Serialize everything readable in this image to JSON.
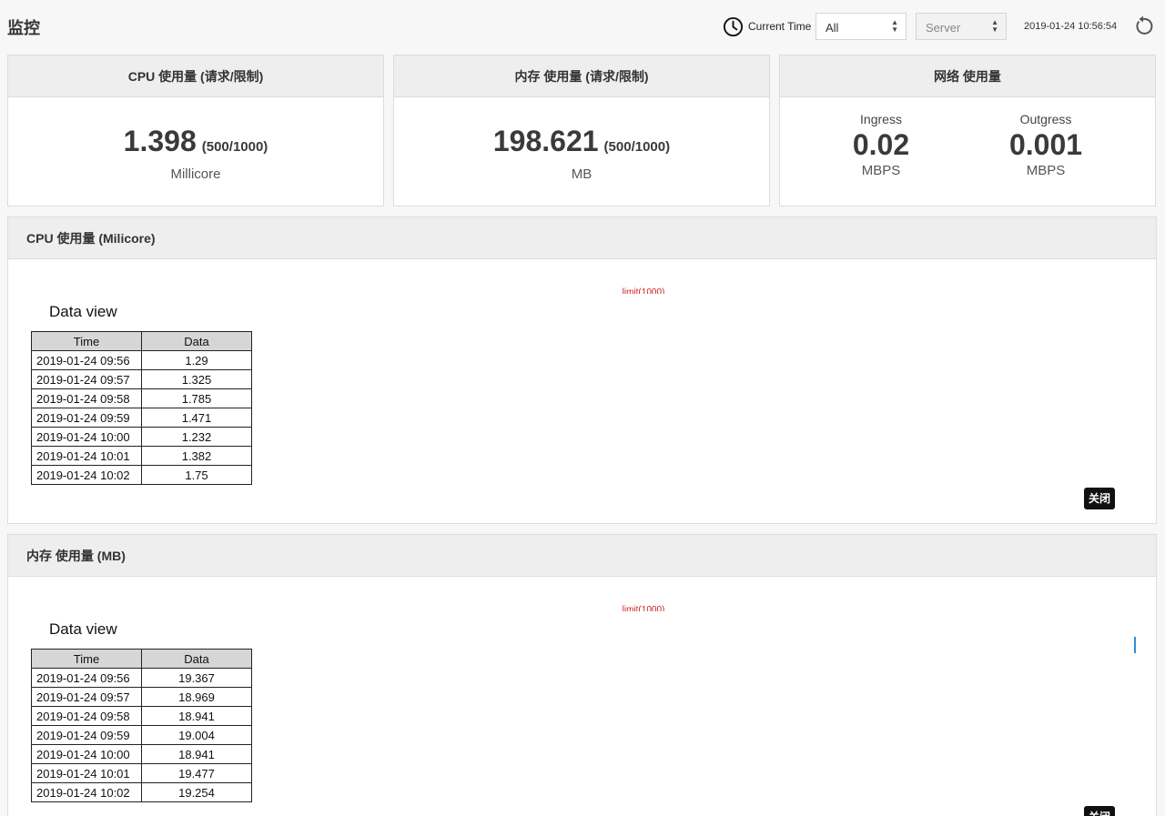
{
  "header": {
    "title": "监控",
    "current_time_label": "Current Time",
    "range_select": "All",
    "server_select": "Server",
    "timestamp": "2019-01-24 10:56:54",
    "icons": {
      "clock": "clock-icon",
      "refresh": "refresh-icon"
    }
  },
  "cards": {
    "cpu": {
      "title": "CPU 使用量 (请求/限制)",
      "value": "1.398",
      "limit": "(500/1000)",
      "unit": "Millicore"
    },
    "memory": {
      "title": "内存 使用量 (请求/限制)",
      "value": "198.621",
      "limit": "(500/1000)",
      "unit": "MB"
    },
    "network": {
      "title": "网络 使用量",
      "ingress": {
        "label": "Ingress",
        "value": "0.02",
        "unit": "MBPS"
      },
      "outgress": {
        "label": "Outgress",
        "value": "0.001",
        "unit": "MBPS"
      }
    }
  },
  "cpu_panel": {
    "title": "CPU 使用量 (Milicore)",
    "limit_label": "limit(1000)",
    "dataview_title": "Data view",
    "columns": [
      "Time",
      "Data"
    ],
    "rows": [
      [
        "2019-01-24 09:56",
        "1.29"
      ],
      [
        "2019-01-24 09:57",
        "1.325"
      ],
      [
        "2019-01-24 09:58",
        "1.785"
      ],
      [
        "2019-01-24 09:59",
        "1.471"
      ],
      [
        "2019-01-24 10:00",
        "1.232"
      ],
      [
        "2019-01-24 10:01",
        "1.382"
      ],
      [
        "2019-01-24 10:02",
        "1.75"
      ]
    ],
    "close_label": "关闭"
  },
  "memory_panel": {
    "title": "内存 使用量 (MB)",
    "limit_label": "limit(1000)",
    "dataview_title": "Data view",
    "columns": [
      "Time",
      "Data"
    ],
    "rows": [
      [
        "2019-01-24 09:56",
        "19.367"
      ],
      [
        "2019-01-24 09:57",
        "18.969"
      ],
      [
        "2019-01-24 09:58",
        "18.941"
      ],
      [
        "2019-01-24 09:59",
        "19.004"
      ],
      [
        "2019-01-24 10:00",
        "18.941"
      ],
      [
        "2019-01-24 10:01",
        "19.477"
      ],
      [
        "2019-01-24 10:02",
        "19.254"
      ]
    ],
    "close_label": "关闭"
  },
  "colors": {
    "limit_line": "#d02020",
    "header_bg": "#eeeeee",
    "accent_blue": "#2e8fd8"
  }
}
